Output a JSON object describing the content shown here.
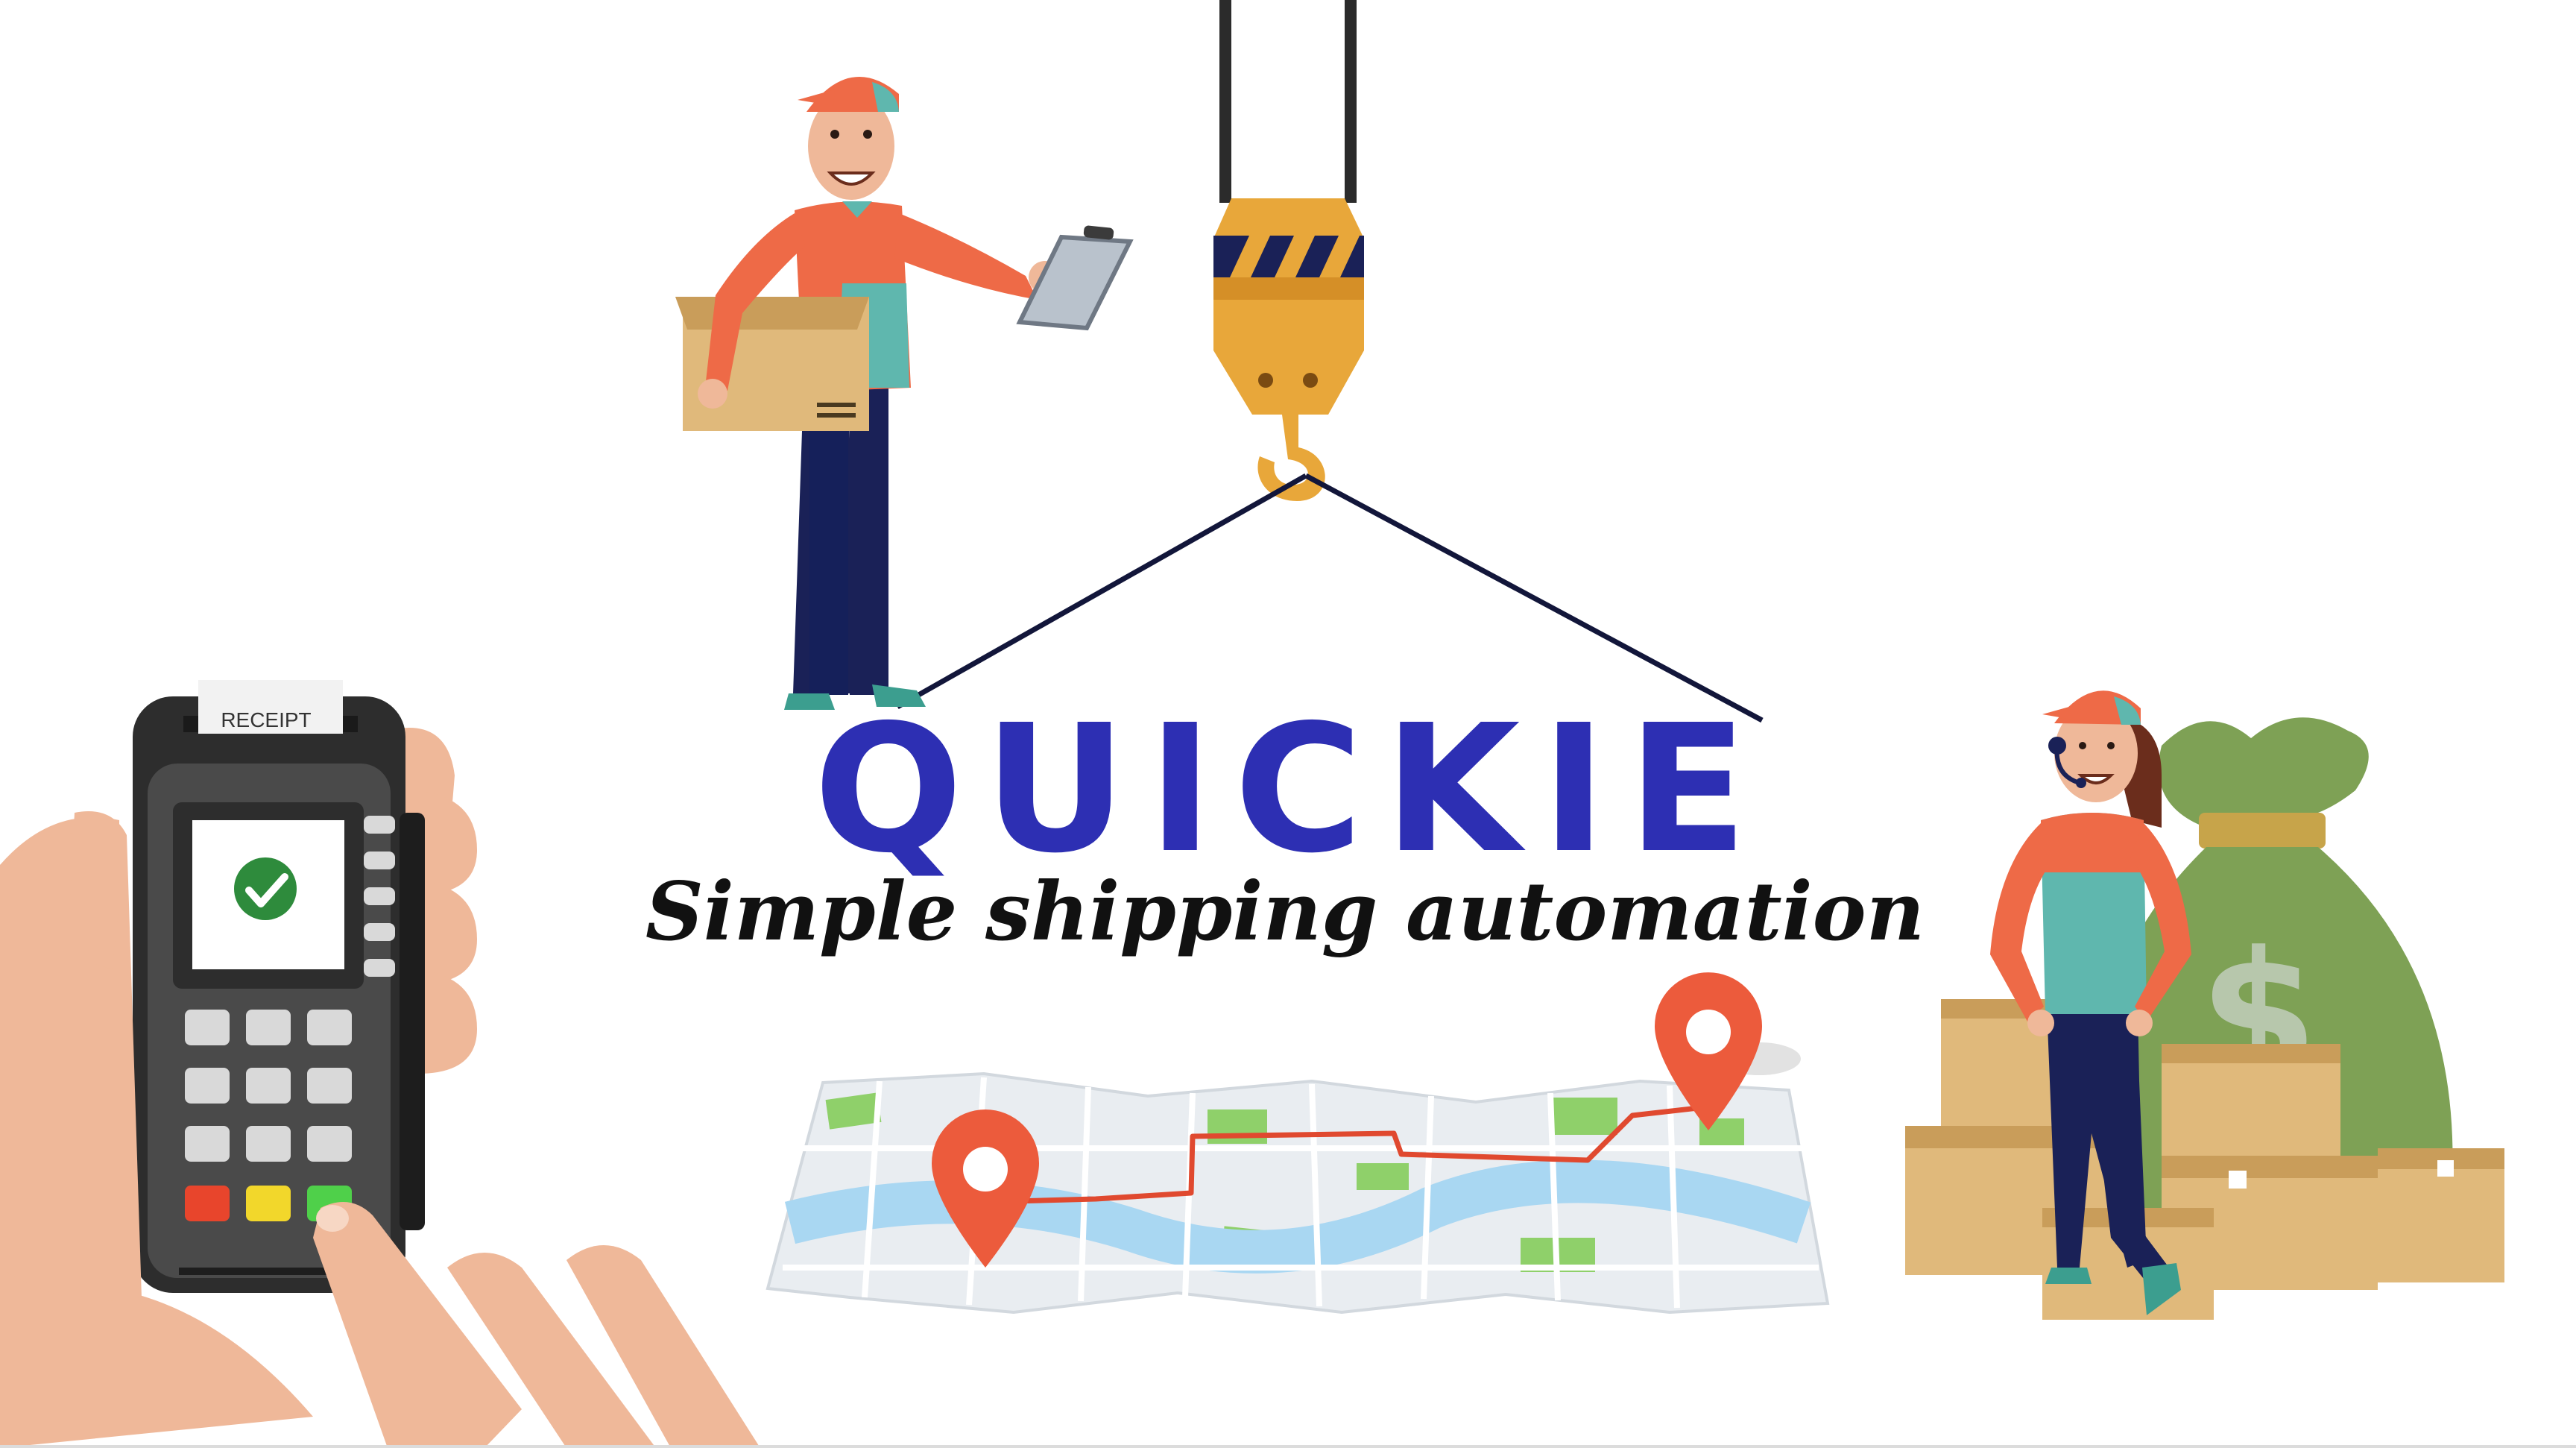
{
  "brand": {
    "title": "QUICKIE",
    "tagline": "Simple shipping automation",
    "title_color": "#2d2fb3",
    "tagline_color": "#111111"
  },
  "terminal": {
    "receipt_label": "RECEIPT",
    "status": "payment-approved"
  },
  "colors": {
    "background": "#ffffff",
    "uniform_orange": "#ee6a47",
    "uniform_teal": "#5fb7ae",
    "trousers_navy": "#1a2157",
    "cardboard": "#e0b97b",
    "hook_yellow": "#e8a73a",
    "map_pin": "#ec5b3c",
    "money_bag": "#7ea155",
    "skin": "#efb899"
  },
  "icons": [
    "delivery-man-icon",
    "crane-hook-icon",
    "payment-terminal-icon",
    "checkmark-icon",
    "map-icon",
    "map-pin-icon",
    "support-agent-icon",
    "money-bag-icon",
    "box-stack-icon"
  ]
}
